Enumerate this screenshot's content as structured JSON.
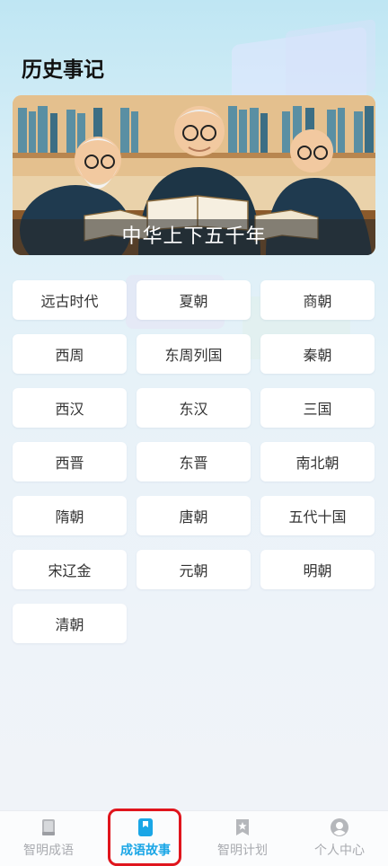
{
  "header": {
    "title": "历史事记"
  },
  "banner": {
    "caption": "中华上下五千年"
  },
  "eras": [
    "远古时代",
    "夏朝",
    "商朝",
    "西周",
    "东周列国",
    "秦朝",
    "西汉",
    "东汉",
    "三国",
    "西晋",
    "东晋",
    "南北朝",
    "隋朝",
    "唐朝",
    "五代十国",
    "宋辽金",
    "元朝",
    "明朝",
    "清朝"
  ],
  "tabbar": {
    "tabs": [
      {
        "label": "智明成语",
        "icon": "book-icon",
        "active": false
      },
      {
        "label": "成语故事",
        "icon": "bookmark-book-icon",
        "active": true
      },
      {
        "label": "智明计划",
        "icon": "star-bookmark-icon",
        "active": false
      },
      {
        "label": "个人中心",
        "icon": "user-icon",
        "active": false
      }
    ]
  },
  "colors": {
    "accent": "#1aa6e6",
    "inactive": "#a9abb0",
    "highlight": "#e0151d"
  }
}
